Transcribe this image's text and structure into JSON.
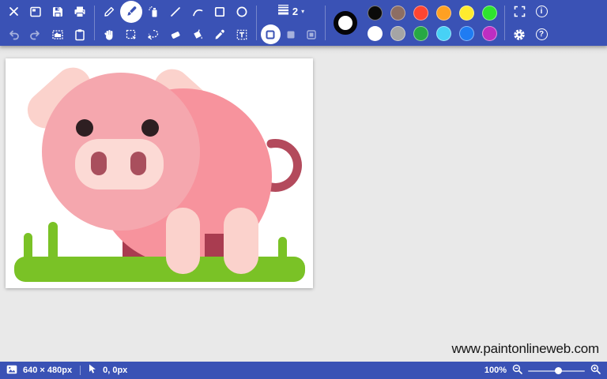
{
  "app": {
    "watermark": "www.paintonlineweb.com"
  },
  "toolbar": {
    "bg_color": "#3A52B5",
    "file_row": [
      "close-icon",
      "new-image-icon",
      "save-icon",
      "print-icon"
    ],
    "edit_row": [
      "undo-icon",
      "redo-icon",
      "resize-image-icon",
      "paste-icon"
    ],
    "draw_row": [
      "pencil-icon",
      "brush-icon",
      "spray-icon",
      "line-icon",
      "curve-icon",
      "rectangle-icon",
      "ellipse-icon"
    ],
    "select_row": [
      "hand-icon",
      "rect-select-icon",
      "lasso-select-icon",
      "eraser-icon",
      "fill-bucket-icon",
      "eyedropper-icon",
      "text-icon"
    ],
    "selected_tool": "brush",
    "disabled_tools": [
      "undo",
      "redo"
    ],
    "line_width": {
      "value": "2",
      "caret": "▾"
    },
    "fill_styles": [
      "outline",
      "filled",
      "filled-outline"
    ],
    "selected_fill_style": "outline",
    "right_icons": [
      "fullscreen-icon",
      "info-icon",
      "settings-gear-icon",
      "help-icon"
    ],
    "glyphs": {
      "info": "i",
      "help": "?"
    }
  },
  "palette": {
    "current_color": "#FFFFFF",
    "row1": [
      "#0A0A0A",
      "#8D6E63",
      "#FF4532",
      "#FFA022",
      "#FFEB2E",
      "#2EE52E"
    ],
    "row2": [
      "#FFFFFF",
      "#A5A5A5",
      "#27A844",
      "#47D1F5",
      "#1F7CF2",
      "#BE2EC2"
    ]
  },
  "canvas": {
    "artwork": {
      "subject": "flat-style pink pig standing on green grass",
      "colors": {
        "head": "#F5A7AE",
        "body": "#F7939D",
        "light": "#FBD2CC",
        "snout": "#FCDAD5",
        "nostril": "#A94F5D",
        "eye": "#2E1F22",
        "tail": "#B34A5C",
        "leg_dark": "#A93C50",
        "grass": "#7AC226",
        "background": "#FFFFFF"
      }
    }
  },
  "statusbar": {
    "image_size": "640 × 480px",
    "cursor_position": "0, 0px",
    "zoom_level": "100%"
  }
}
